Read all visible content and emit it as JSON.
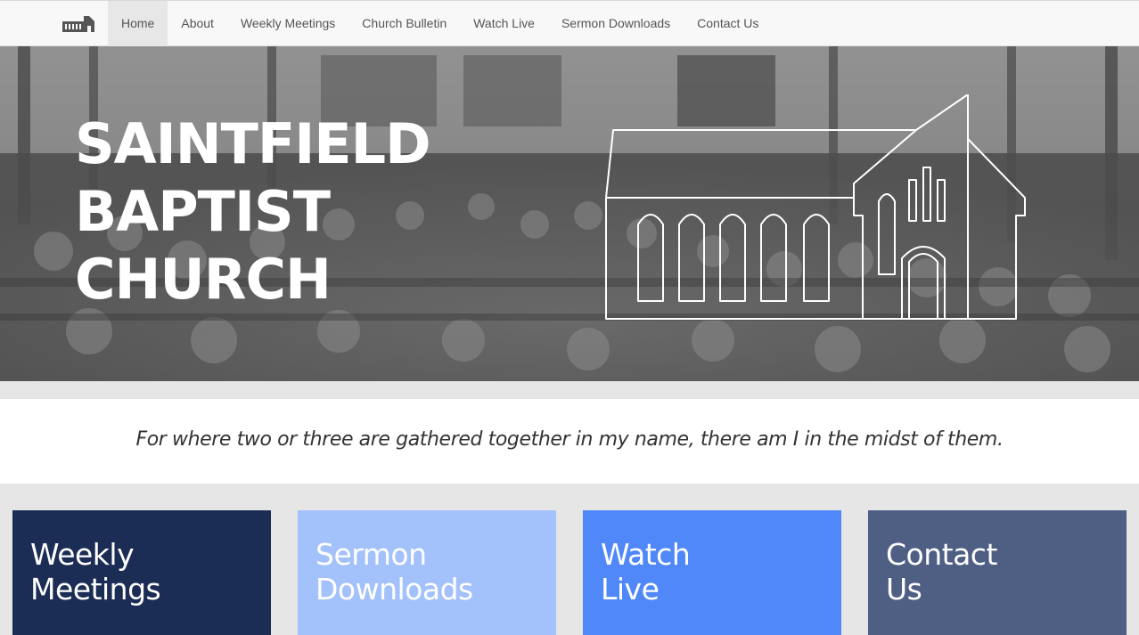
{
  "nav": {
    "brand_icon": "church-logo-icon",
    "items": [
      {
        "label": "Home",
        "active": true
      },
      {
        "label": "About",
        "active": false
      },
      {
        "label": "Weekly Meetings",
        "active": false
      },
      {
        "label": "Church Bulletin",
        "active": false
      },
      {
        "label": "Watch Live",
        "active": false
      },
      {
        "label": "Sermon Downloads",
        "active": false
      },
      {
        "label": "Contact Us",
        "active": false
      }
    ]
  },
  "hero": {
    "title_lines": [
      "SAINTFIELD",
      "BAPTIST",
      "CHURCH"
    ],
    "illustration": "church-outline-icon",
    "photo": "congregation-photo"
  },
  "verse": "For where two or three are gathered together in my name, there am I in the midst of them.",
  "tiles": [
    {
      "lines": [
        "Weekly",
        "Meetings"
      ],
      "color": "#1c2d55"
    },
    {
      "lines": [
        "Sermon",
        "Downloads"
      ],
      "color": "#a3c1fb"
    },
    {
      "lines": [
        "Watch",
        "Live"
      ],
      "color": "#5088f9"
    },
    {
      "lines": [
        "Contact",
        "Us"
      ],
      "color": "#4f5f83"
    }
  ]
}
